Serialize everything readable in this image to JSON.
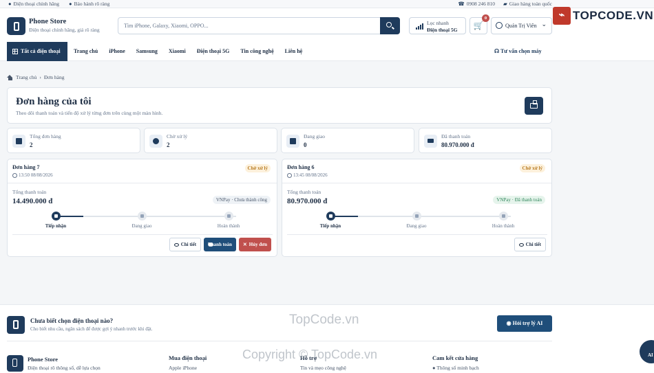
{
  "topbar": {
    "left": [
      "Điện thoại chính hãng",
      "Bảo hành rõ ràng"
    ],
    "phone": "0908 246 810",
    "shipping": "Giao hàng toàn quốc"
  },
  "header": {
    "brand_name": "Phone Store",
    "brand_tagline": "Điện thoại chính hãng, giá rõ ràng",
    "search_placeholder": "Tìm iPhone, Galaxy, Xiaomi, OPPO...",
    "filter_label": "Lọc nhanh",
    "filter_value": "Điện thoại 5G",
    "cart_count": "0",
    "user_name": "Quản Trị Viên"
  },
  "watermark_logo": "TOPCODE.VN",
  "nav": {
    "all_label": "Tất cả điện thoại",
    "items": [
      "Trang chủ",
      "iPhone",
      "Samsung",
      "Xiaomi",
      "Điện thoại 5G",
      "Tin công nghệ",
      "Liên hệ"
    ],
    "advice": "Tư vấn chọn máy"
  },
  "breadcrumb": {
    "home": "Trang chủ",
    "current": "Đơn hàng"
  },
  "page": {
    "title": "Đơn hàng của tôi",
    "subtitle": "Theo dõi thanh toán và tiến độ xử lý từng đơn trên cùng một màn hình."
  },
  "stats": [
    {
      "label": "Tổng đơn hàng",
      "value": "2"
    },
    {
      "label": "Chờ xử lý",
      "value": "2"
    },
    {
      "label": "Đang giao",
      "value": "0"
    },
    {
      "label": "Đã thanh toán",
      "value": "80.970.000 đ"
    }
  ],
  "orders": [
    {
      "name": "Đơn hàng 7",
      "time": "13:50 08/08/2026",
      "status": "Chờ xử lý",
      "total_label": "Tổng thanh toán",
      "total": "14.490.000 đ",
      "payment": "VNPay · Chưa thành công",
      "steps": [
        "Tiếp nhận",
        "Đang giao",
        "Hoàn thành"
      ],
      "buttons": {
        "detail": "Chi tiết",
        "pay": "Thanh toán",
        "cancel": "Hủy đơn"
      }
    },
    {
      "name": "Đơn hàng 6",
      "time": "13:45 08/08/2026",
      "status": "Chờ xử lý",
      "total_label": "Tổng thanh toán",
      "total": "80.970.000 đ",
      "payment": "VNPay · Đã thanh toán",
      "steps": [
        "Tiếp nhận",
        "Đang giao",
        "Hoàn thành"
      ],
      "buttons": {
        "detail": "Chi tiết"
      }
    }
  ],
  "help": {
    "title": "Chưa biết chọn điện thoại nào?",
    "subtitle": "Cho biết nhu cầu, ngân sách để được gợi ý nhanh trước khi đặt.",
    "button": "Hỏi trợ lý AI"
  },
  "footer": {
    "brand_name": "Phone Store",
    "brand_tagline": "Điện thoại rõ thông số, dễ lựa chọn",
    "cols": [
      {
        "title": "Mua điện thoại",
        "first": "Apple iPhone"
      },
      {
        "title": "Hỗ trợ",
        "first": "Tin và mẹo công nghệ"
      },
      {
        "title": "Cam kết cửa hàng",
        "first": "Thông số minh bạch"
      }
    ]
  },
  "float_ai": "AI",
  "watermarks": [
    "TopCode.vn",
    "Copyright © TopCode.vn"
  ]
}
